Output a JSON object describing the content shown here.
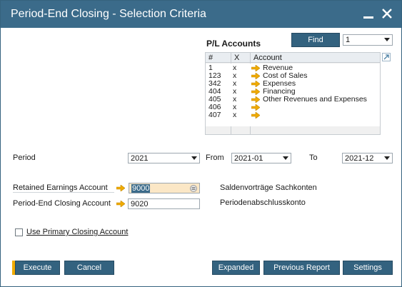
{
  "window": {
    "title": "Period-End Closing - Selection Criteria",
    "minimize_icon": "minimize-icon",
    "close_icon": "close-icon"
  },
  "pl_accounts": {
    "title": "P/L Accounts",
    "find_label": "Find",
    "find_select_value": "1",
    "columns": [
      "#",
      "X",
      "Account"
    ],
    "rows": [
      {
        "num": "1",
        "x": "x",
        "account": "Revenue"
      },
      {
        "num": "123",
        "x": "x",
        "account": "Cost of Sales"
      },
      {
        "num": "342",
        "x": "x",
        "account": "Expenses"
      },
      {
        "num": "404",
        "x": "x",
        "account": "Financing"
      },
      {
        "num": "405",
        "x": "x",
        "account": "Other Revenues and Expenses"
      },
      {
        "num": "406",
        "x": "x",
        "account": ""
      },
      {
        "num": "407",
        "x": "x",
        "account": ""
      }
    ],
    "corner_icon": "expand-corner-icon"
  },
  "period": {
    "label": "Period",
    "value": "2021",
    "from_label": "From",
    "from_value": "2021-01",
    "to_label": "To",
    "to_value": "2021-12"
  },
  "retained_earnings": {
    "label": "Retained Earnings Account",
    "value": "9000",
    "description": "Saldenvorträge Sachkonten"
  },
  "period_end_closing": {
    "label": "Period-End Closing Account",
    "value": "9020",
    "description": "Periodenabschlusskonto"
  },
  "use_primary": {
    "label": "Use Primary Closing Account",
    "checked": false
  },
  "buttons": {
    "execute": "Execute",
    "cancel": "Cancel",
    "expanded": "Expanded",
    "previous_report": "Previous Report",
    "settings": "Settings"
  },
  "colors": {
    "titlebar": "#3b6b8a",
    "button": "#33627f",
    "link_arrow": "#f0ab00",
    "highlight_field": "#fbe7c6"
  }
}
